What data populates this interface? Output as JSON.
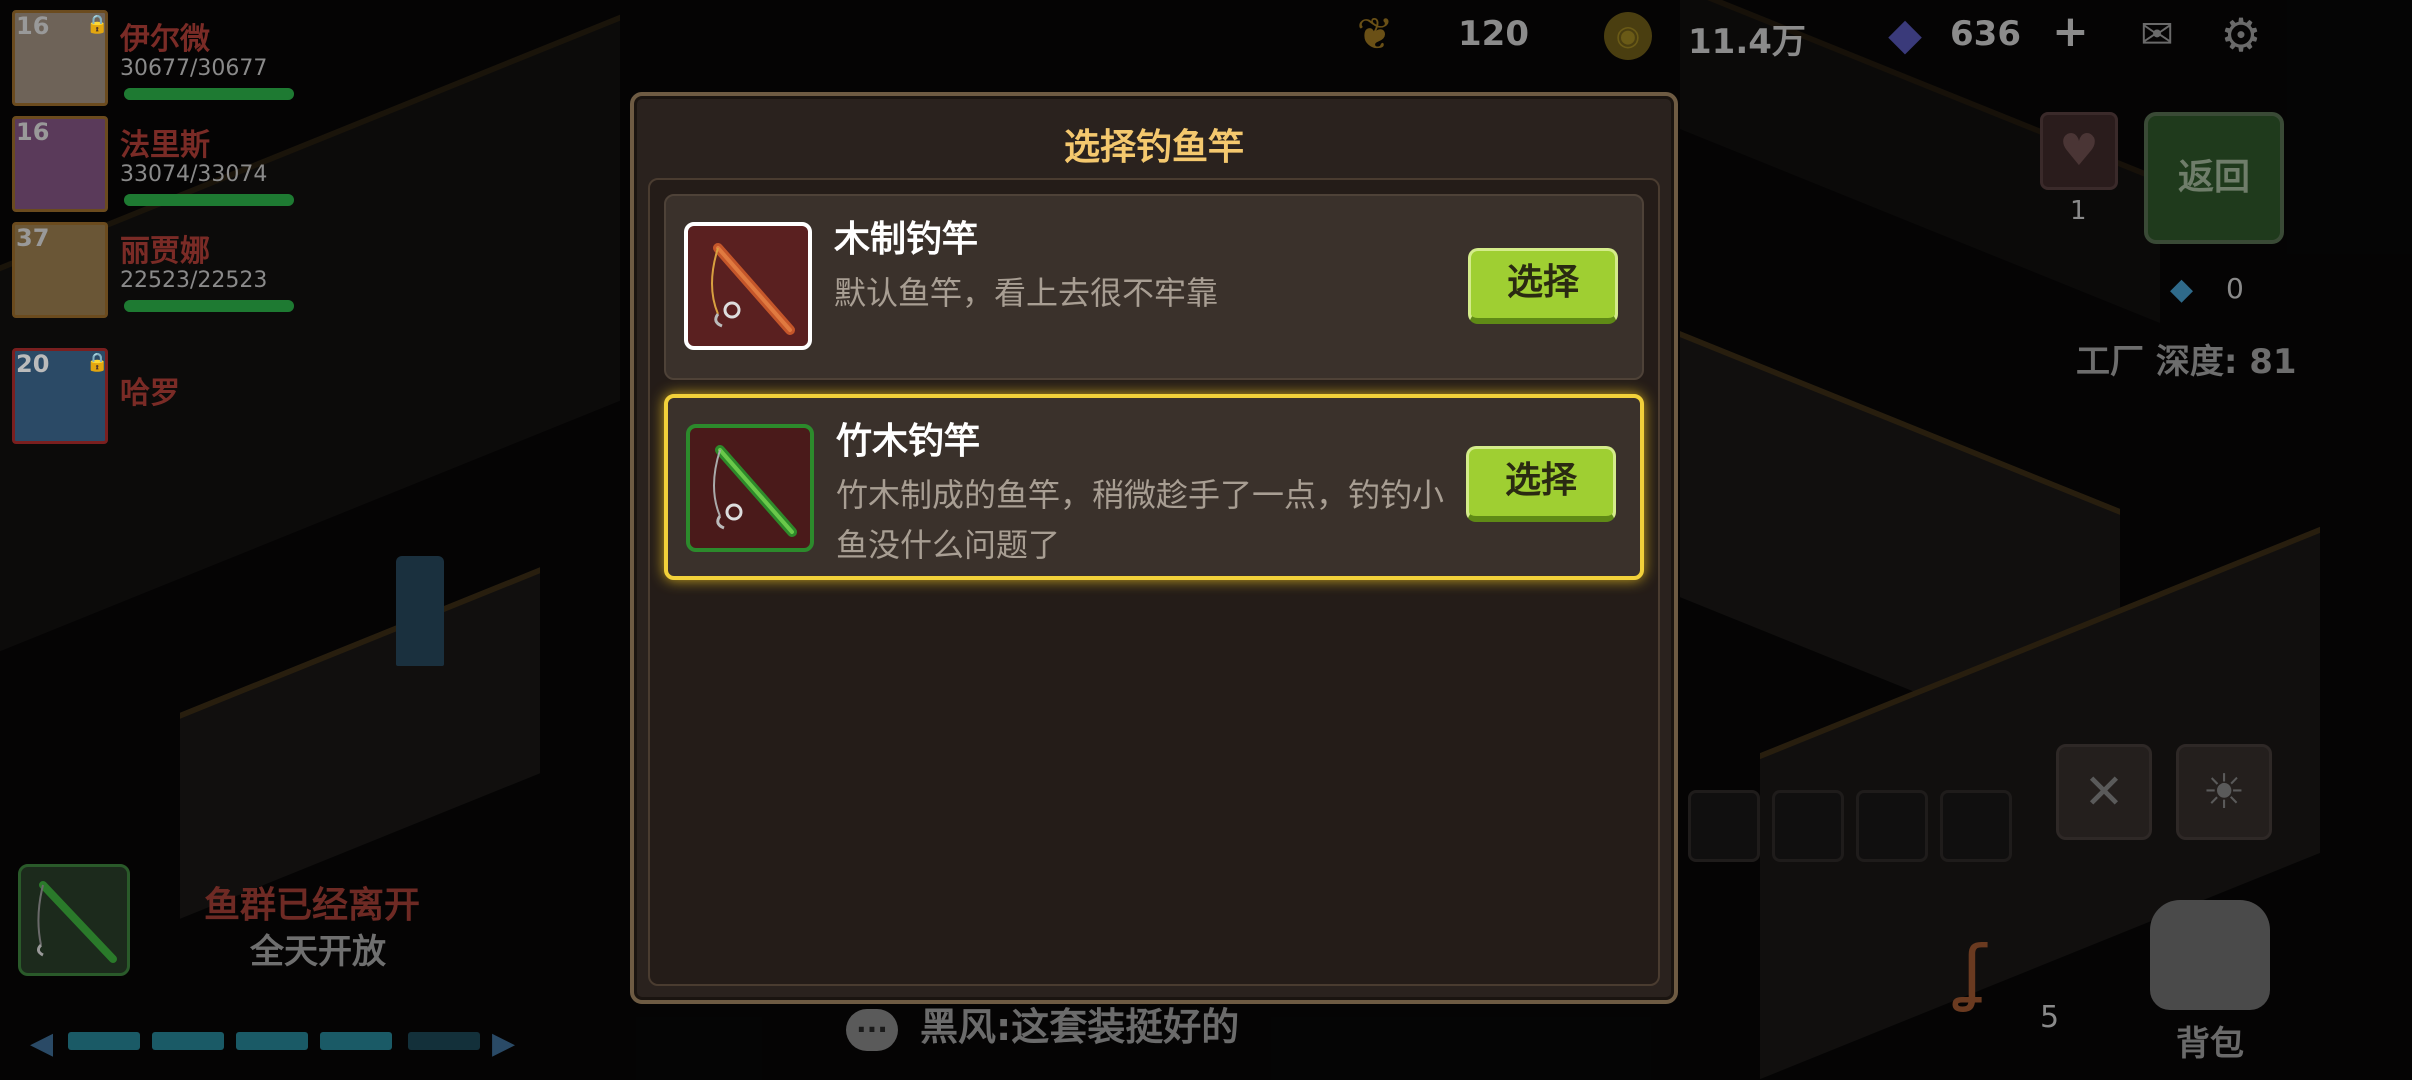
{
  "party": [
    {
      "level": "16",
      "name": "伊尔微",
      "hp": "30677/30677",
      "hp_fraction": 1.0,
      "locked": true
    },
    {
      "level": "16",
      "name": "法里斯",
      "hp": "33074/33074",
      "hp_fraction": 1.0,
      "locked": false
    },
    {
      "level": "37",
      "name": "丽贾娜",
      "hp": "22523/22523",
      "hp_fraction": 1.0,
      "locked": false
    },
    {
      "level": "20",
      "name": "哈罗",
      "hp": "",
      "hp_fraction": 0,
      "locked": true
    }
  ],
  "resources": {
    "wheat": "120",
    "gold": "11.4万",
    "diamond": "636",
    "add_symbol": "+",
    "mail_icon": "mail-icon",
    "settings_icon": "gear-icon"
  },
  "right_panel": {
    "back_label": "返回",
    "heart_count": "1",
    "gem_count": "0",
    "depth_text": "工厂 深度: 81"
  },
  "bottom_left": {
    "fish_status": "鱼群已经离开",
    "open_status": "全天开放"
  },
  "bottom_right": {
    "hook_count": "5",
    "bag_label": "背包"
  },
  "chat": {
    "message": "黑风:这套装挺好的"
  },
  "modal": {
    "title": "选择钓鱼竿",
    "rods": [
      {
        "name": "木制钓竿",
        "description": "默认鱼竿，看上去很不牢靠",
        "button": "选择",
        "selected": false
      },
      {
        "name": "竹木钓竿",
        "description": "竹木制成的鱼竿，稍微趁手了一点，钓钓小鱼没什么问题了",
        "button": "选择",
        "selected": true
      }
    ]
  },
  "colors": {
    "title_gold": "#f4c86e",
    "select_green": "#9fcf32",
    "highlight_yellow": "#f2d13a"
  }
}
